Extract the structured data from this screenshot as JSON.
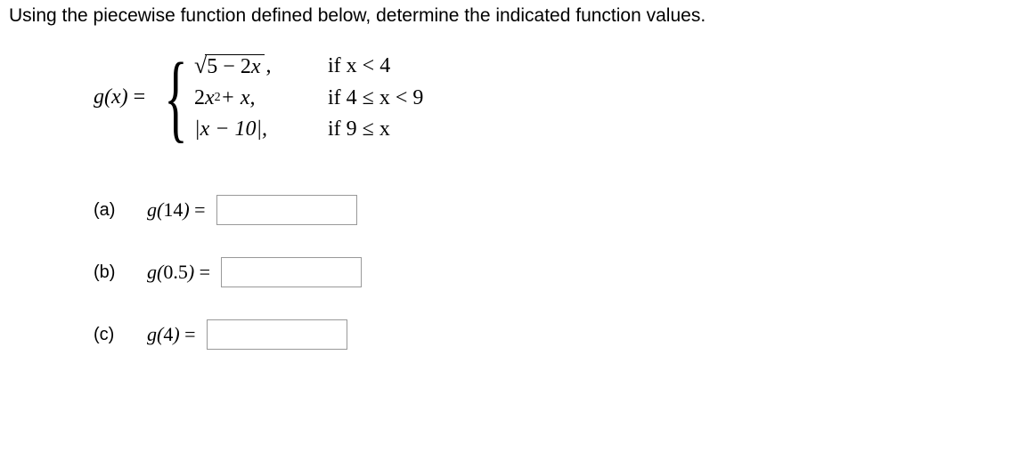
{
  "instruction": "Using the piecewise function defined below, determine the indicated function values.",
  "function": {
    "lhs_name": "g",
    "lhs_arg": "x",
    "pieces": [
      {
        "expr_left": "5 − 2",
        "expr_var": "x",
        "comma": " ,",
        "cond": "if x < 4"
      },
      {
        "coef": "2",
        "var": "x",
        "exp": "2",
        "rest": " + x,",
        "cond": "if 4 ≤ x < 9"
      },
      {
        "abs": "|x − 10|,",
        "cond": "if 9 ≤ x"
      }
    ]
  },
  "parts": [
    {
      "label": "(a)",
      "fn": "g",
      "arg": "14",
      "value": ""
    },
    {
      "label": "(b)",
      "fn": "g",
      "arg": "0.5",
      "value": ""
    },
    {
      "label": "(c)",
      "fn": "g",
      "arg": "4",
      "value": ""
    }
  ]
}
